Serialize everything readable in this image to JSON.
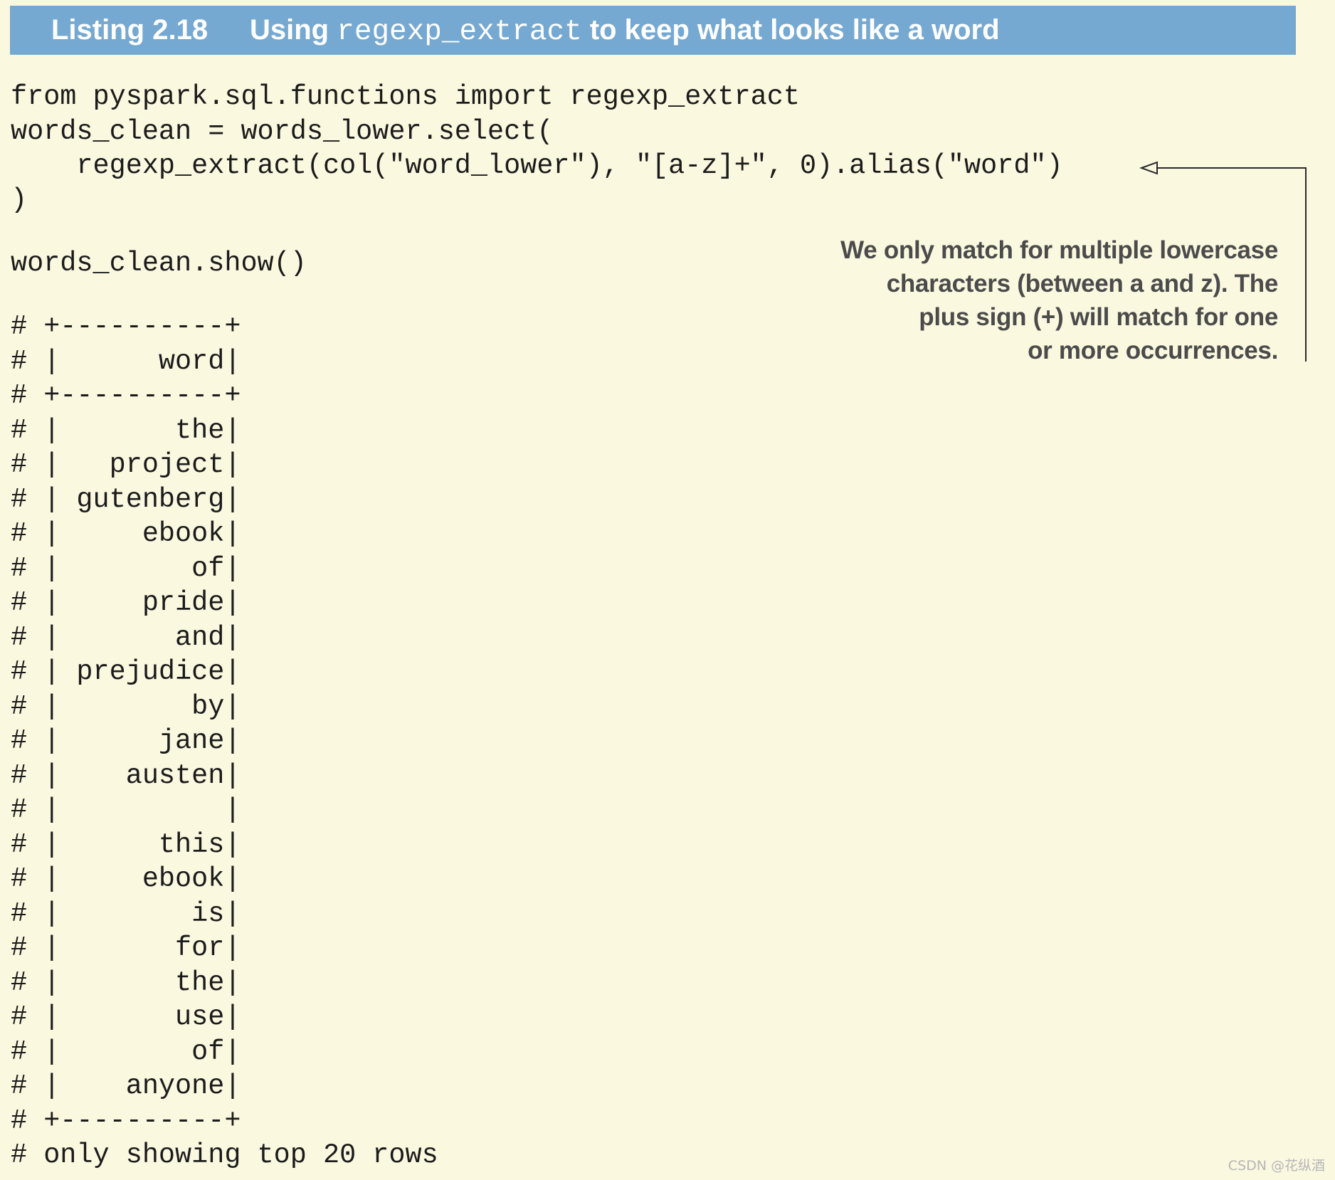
{
  "listing": {
    "number": "Listing 2.18",
    "title_prefix": "Using ",
    "title_code": "regexp_extract",
    "title_suffix": " to keep what looks like a word"
  },
  "code_lines": [
    "from pyspark.sql.functions import regexp_extract",
    "words_clean = words_lower.select(",
    "    regexp_extract(col(\"word_lower\"), \"[a-z]+\", 0).alias(\"word\")",
    ")",
    "",
    "words_clean.show()",
    "",
    "# +----------+",
    "# |      word|",
    "# +----------+",
    "# |       the|",
    "# |   project|",
    "# | gutenberg|",
    "# |     ebook|",
    "# |        of|",
    "# |     pride|",
    "# |       and|",
    "# | prejudice|",
    "# |        by|",
    "# |      jane|",
    "# |    austen|",
    "# |          |",
    "# |      this|",
    "# |     ebook|",
    "# |        is|",
    "# |       for|",
    "# |       the|",
    "# |       use|",
    "# |        of|",
    "# |    anyone|",
    "# +----------+",
    "# only showing top 20 rows"
  ],
  "annotation": {
    "line1": "We only match for multiple lowercase",
    "line2": "characters (between a and z). The",
    "line3": "plus sign (+) will match for one",
    "line4": "or more occurrences."
  },
  "watermark": "CSDN @花纵酒"
}
